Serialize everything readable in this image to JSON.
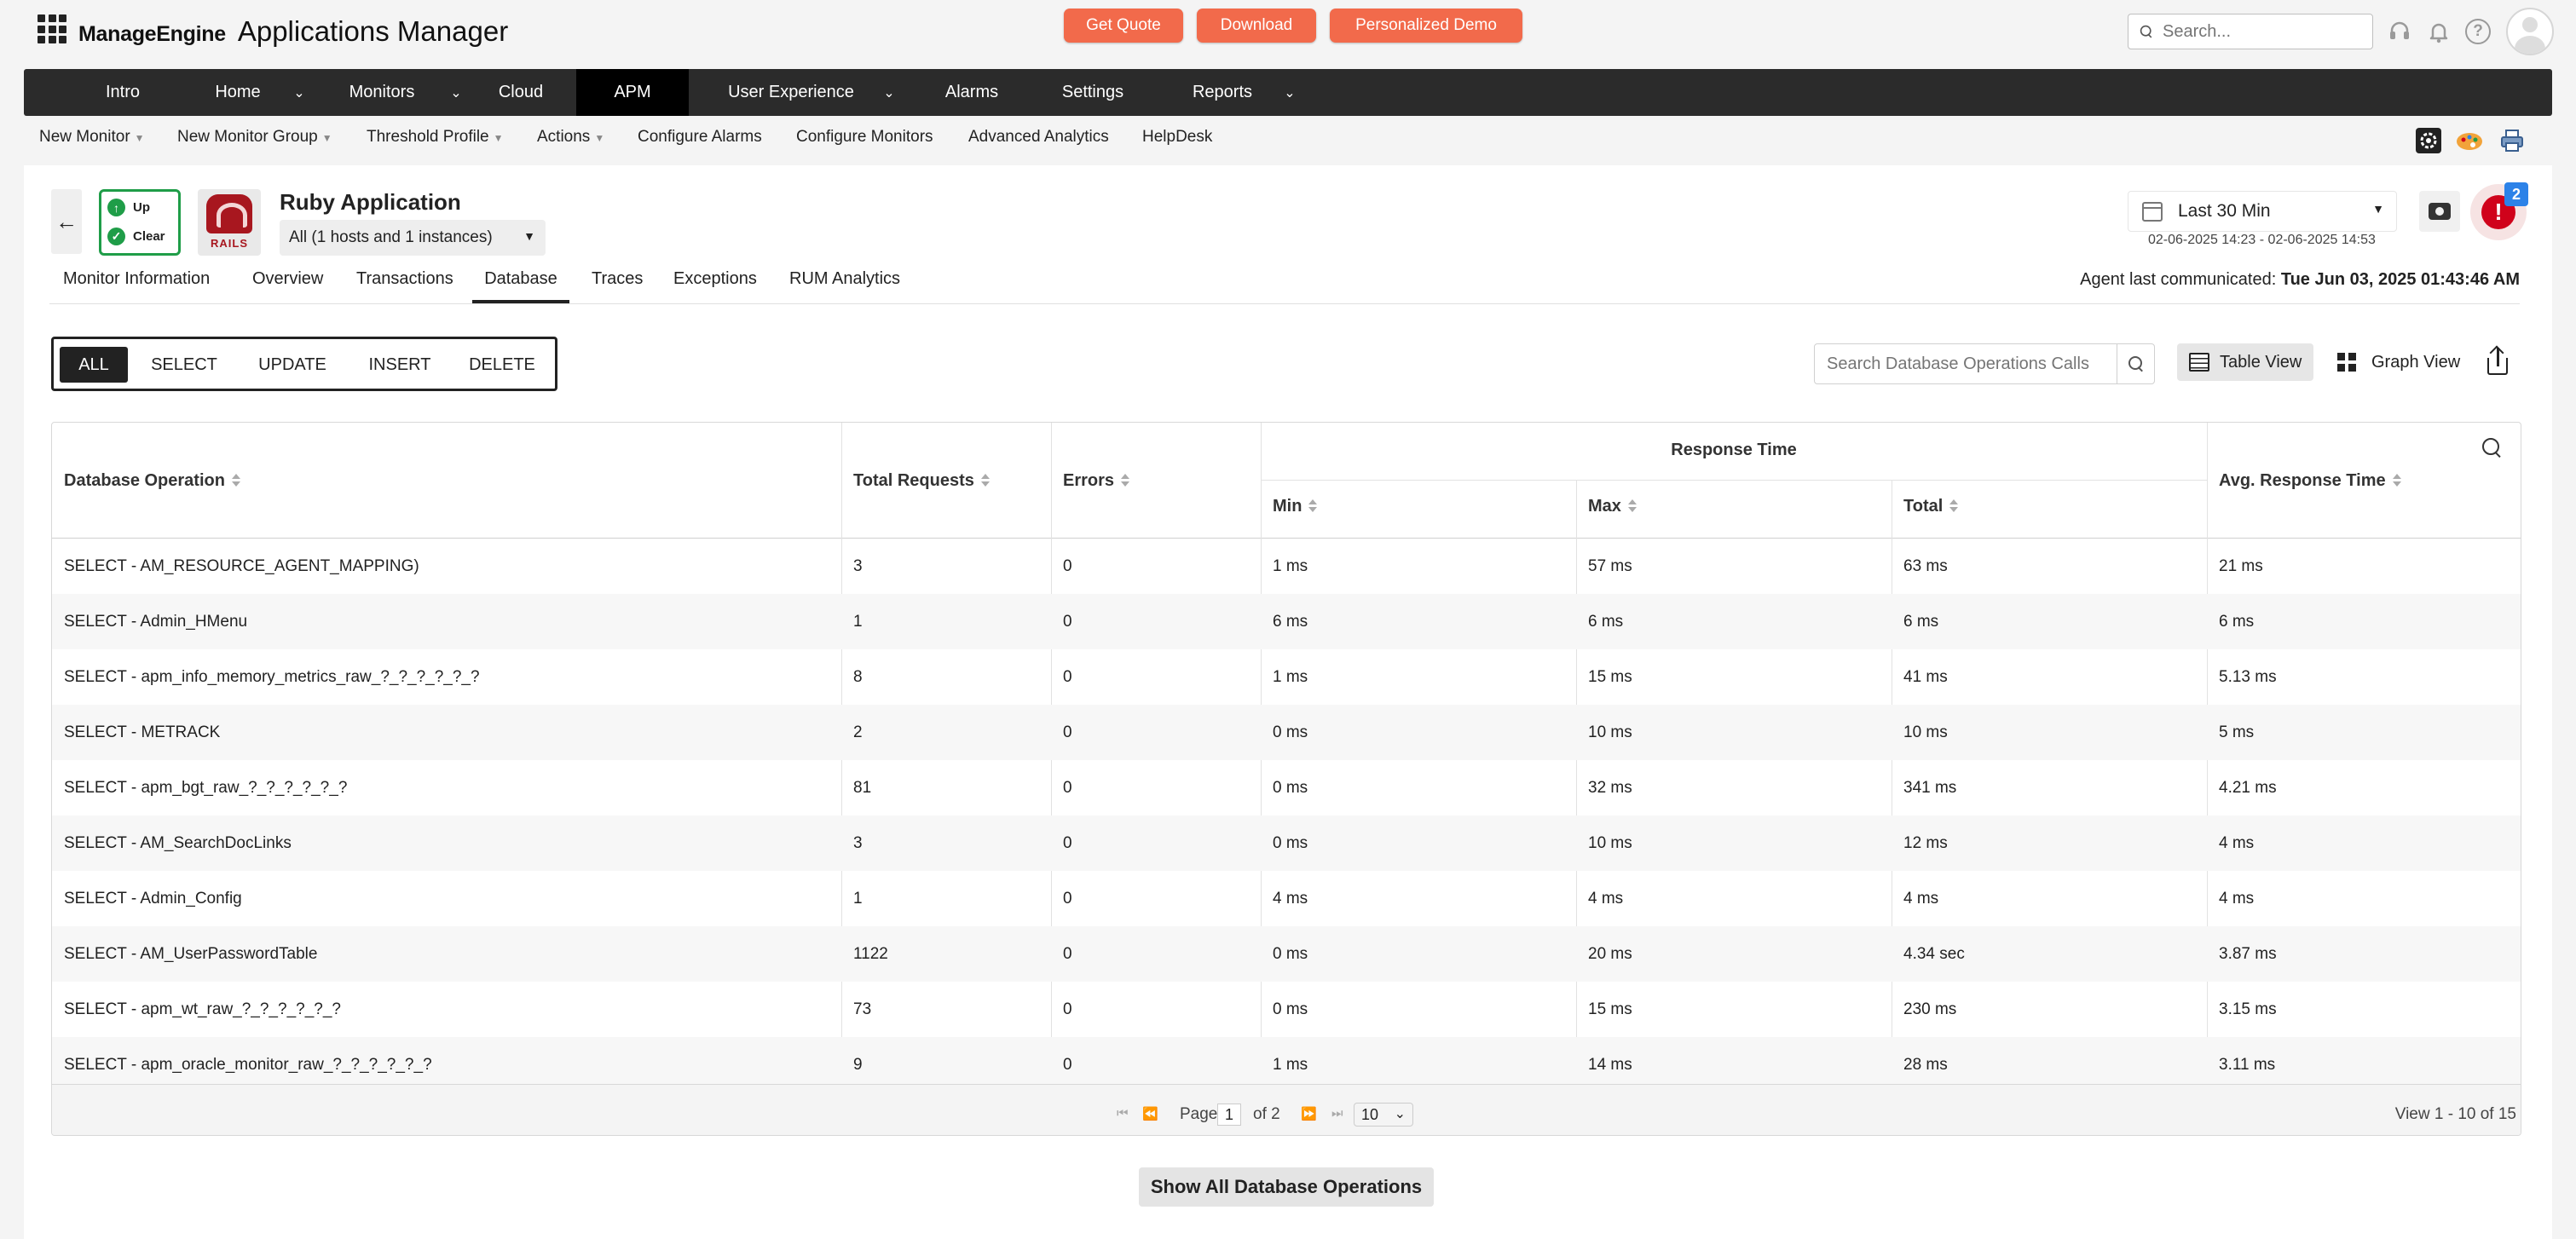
{
  "header": {
    "brand": "ManageEngine",
    "app_title": "Applications Manager",
    "buttons": [
      "Get Quote",
      "Download",
      "Personalized Demo"
    ],
    "search_placeholder": "Search...",
    "accent_color": "#f26a4b",
    "icons": [
      "apps-grid-icon",
      "headset-icon",
      "bell-icon",
      "help-icon",
      "user-avatar"
    ]
  },
  "main_nav": {
    "items": [
      "Intro",
      "Home",
      "Monitors",
      "Cloud",
      "APM",
      "User Experience",
      "Alarms",
      "Settings",
      "Reports"
    ],
    "active": "APM"
  },
  "sub_nav": {
    "items": [
      "New Monitor",
      "New Monitor Group",
      "Threshold Profile",
      "Actions",
      "Configure Alarms",
      "Configure Monitors",
      "Advanced Analytics",
      "HelpDesk"
    ]
  },
  "monitor": {
    "status_up": "Up",
    "status_clear": "Clear",
    "logo_text": "RAILS",
    "title": "Ruby Application",
    "instance_select": "All (1 hosts and 1 instances)",
    "time_period": "Last 30 Min",
    "time_range": "02-06-2025 14:23 - 02-06-2025 14:53",
    "alarm_count": "2",
    "alarm_symbol": "!",
    "agent_label": "Agent last communicated:",
    "agent_time": "Tue Jun 03, 2025 01:43:46 AM"
  },
  "tabs": {
    "items": [
      "Monitor Information",
      "Overview",
      "Transactions",
      "Database",
      "Traces",
      "Exceptions",
      "RUM Analytics"
    ],
    "active": "Database"
  },
  "filters": {
    "items": [
      "ALL",
      "SELECT",
      "UPDATE",
      "INSERT",
      "DELETE"
    ],
    "active": "ALL",
    "search_placeholder": "Search Database Operations Calls",
    "table_view": "Table View",
    "graph_view": "Graph View"
  },
  "table": {
    "headers": {
      "operation": "Database Operation",
      "total_requests": "Total Requests",
      "errors": "Errors",
      "response_time": "Response Time",
      "min": "Min",
      "max": "Max",
      "total": "Total",
      "avg": "Avg. Response Time"
    },
    "rows": [
      [
        "SELECT - AM_RESOURCE_AGENT_MAPPING)",
        "3",
        "0",
        "1 ms",
        "57 ms",
        "63 ms",
        "21 ms"
      ],
      [
        "SELECT - Admin_HMenu",
        "1",
        "0",
        "6 ms",
        "6 ms",
        "6 ms",
        "6 ms"
      ],
      [
        "SELECT - apm_info_memory_metrics_raw_?_?_?_?_?_?",
        "8",
        "0",
        "1 ms",
        "15 ms",
        "41 ms",
        "5.13 ms"
      ],
      [
        "SELECT - METRACK",
        "2",
        "0",
        "0 ms",
        "10 ms",
        "10 ms",
        "5 ms"
      ],
      [
        "SELECT - apm_bgt_raw_?_?_?_?_?_?",
        "81",
        "0",
        "0 ms",
        "32 ms",
        "341 ms",
        "4.21 ms"
      ],
      [
        "SELECT - AM_SearchDocLinks",
        "3",
        "0",
        "0 ms",
        "10 ms",
        "12 ms",
        "4 ms"
      ],
      [
        "SELECT - Admin_Config",
        "1",
        "0",
        "4 ms",
        "4 ms",
        "4 ms",
        "4 ms"
      ],
      [
        "SELECT - AM_UserPasswordTable",
        "1122",
        "0",
        "0 ms",
        "20 ms",
        "4.34 sec",
        "3.87 ms"
      ],
      [
        "SELECT - apm_wt_raw_?_?_?_?_?_?",
        "73",
        "0",
        "0 ms",
        "15 ms",
        "230 ms",
        "3.15 ms"
      ],
      [
        "SELECT - apm_oracle_monitor_raw_?_?_?_?_?_?",
        "9",
        "0",
        "1 ms",
        "14 ms",
        "28 ms",
        "3.11 ms"
      ]
    ],
    "pager": {
      "page_label": "Page",
      "page": "1",
      "of_label": "of 2",
      "page_size": "10",
      "view_count": "View 1 - 10 of 15"
    },
    "show_all": "Show All Database Operations"
  }
}
